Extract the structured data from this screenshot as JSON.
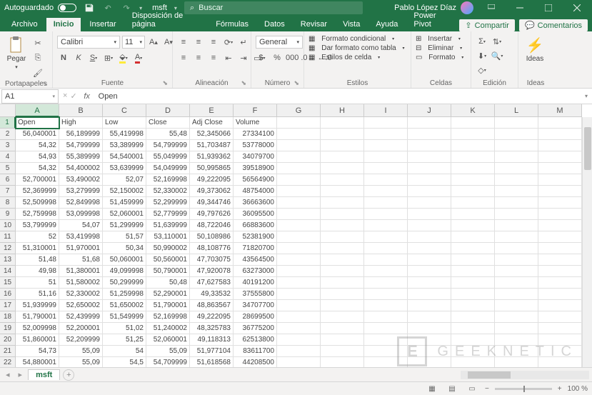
{
  "titlebar": {
    "autosave": "Autoguardado",
    "docname": "msft",
    "search_placeholder": "Buscar",
    "user": "Pablo López Díaz"
  },
  "tabs": {
    "items": [
      "Archivo",
      "Inicio",
      "Insertar",
      "Disposición de página",
      "Fórmulas",
      "Datos",
      "Revisar",
      "Vista",
      "Ayuda",
      "Power Pivot"
    ],
    "active_index": 1,
    "share": "Compartir",
    "comments": "Comentarios"
  },
  "ribbon": {
    "clipboard_label": "Portapapeles",
    "paste": "Pegar",
    "font_label": "Fuente",
    "font_name": "Calibri",
    "font_size": "11",
    "align_label": "Alineación",
    "number_label": "Número",
    "number_format": "General",
    "styles_label": "Estilos",
    "cond_format": "Formato condicional",
    "as_table": "Dar formato como tabla",
    "cell_styles": "Estilos de celda",
    "cells_label": "Celdas",
    "insert": "Insertar",
    "delete": "Eliminar",
    "format": "Formato",
    "editing_label": "Edición",
    "ideas_label": "Ideas",
    "ideas": "Ideas"
  },
  "formulabar": {
    "namebox": "A1",
    "fx": "fx",
    "value": "Open"
  },
  "columns": [
    "A",
    "B",
    "C",
    "D",
    "E",
    "F",
    "G",
    "H",
    "I",
    "J",
    "K",
    "L",
    "M"
  ],
  "headers": [
    "Open",
    "High",
    "Low",
    "Close",
    "Adj Close",
    "Volume"
  ],
  "rows": [
    [
      "56,040001",
      "56,189999",
      "55,419998",
      "55,48",
      "52,345066",
      "27334100"
    ],
    [
      "54,32",
      "54,799999",
      "53,389999",
      "54,799999",
      "51,703487",
      "53778000"
    ],
    [
      "54,93",
      "55,389999",
      "54,540001",
      "55,049999",
      "51,939362",
      "34079700"
    ],
    [
      "54,32",
      "54,400002",
      "53,639999",
      "54,049999",
      "50,995865",
      "39518900"
    ],
    [
      "52,700001",
      "53,490002",
      "52,07",
      "52,169998",
      "49,222095",
      "56564900"
    ],
    [
      "52,369999",
      "53,279999",
      "52,150002",
      "52,330002",
      "49,373062",
      "48754000"
    ],
    [
      "52,509998",
      "52,849998",
      "51,459999",
      "52,299999",
      "49,344746",
      "36663600"
    ],
    [
      "52,759998",
      "53,099998",
      "52,060001",
      "52,779999",
      "49,797626",
      "36095500"
    ],
    [
      "53,799999",
      "54,07",
      "51,299999",
      "51,639999",
      "48,722046",
      "66883600"
    ],
    [
      "52",
      "53,419998",
      "51,57",
      "53,110001",
      "50,108986",
      "52381900"
    ],
    [
      "51,310001",
      "51,970001",
      "50,34",
      "50,990002",
      "48,108776",
      "71820700"
    ],
    [
      "51,48",
      "51,68",
      "50,060001",
      "50,560001",
      "47,703075",
      "43564500"
    ],
    [
      "49,98",
      "51,380001",
      "49,099998",
      "50,790001",
      "47,920078",
      "63273000"
    ],
    [
      "51",
      "51,580002",
      "50,299999",
      "50,48",
      "47,627583",
      "40191200"
    ],
    [
      "51,16",
      "52,330002",
      "51,259998",
      "52,290001",
      "49,33532",
      "37555800"
    ],
    [
      "51,939999",
      "52,650002",
      "51,650002",
      "51,790001",
      "48,863567",
      "34707700"
    ],
    [
      "51,790001",
      "52,439999",
      "51,549999",
      "52,169998",
      "49,222095",
      "28699500"
    ],
    [
      "52,009998",
      "52,200001",
      "51,02",
      "51,240002",
      "48,325783",
      "36775200"
    ],
    [
      "51,860001",
      "52,209999",
      "51,25",
      "52,060001",
      "49,118313",
      "62513800"
    ],
    [
      "54,73",
      "55,09",
      "54",
      "55,09",
      "51,977104",
      "83611700"
    ],
    [
      "54,880001",
      "55,09",
      "54,5",
      "54,709999",
      "51,618568",
      "44208500"
    ]
  ],
  "sheet": {
    "name": "msft"
  },
  "status": {
    "zoom": "100 %"
  },
  "watermark": {
    "badge": "E",
    "text": "GEEKNETIC"
  }
}
